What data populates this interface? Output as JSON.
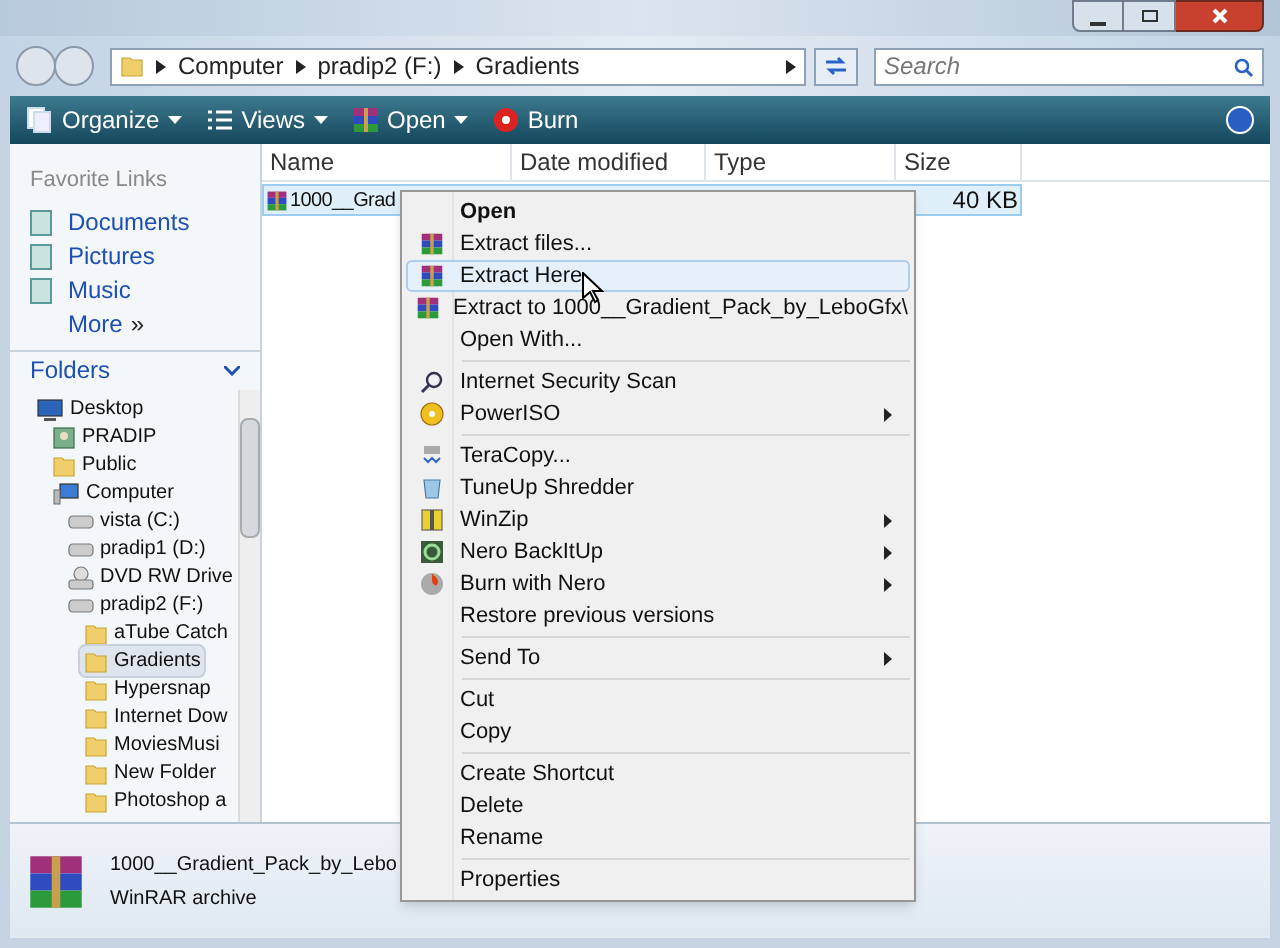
{
  "address": {
    "crumbs": [
      "Computer",
      "pradip2 (F:)",
      "Gradients"
    ]
  },
  "search": {
    "placeholder": "Search"
  },
  "toolbar": [
    "Organize",
    "Views",
    "Open",
    "Burn"
  ],
  "favorites": {
    "title": "Favorite Links",
    "items": [
      "Documents",
      "Pictures",
      "Music"
    ],
    "more": "More",
    "more_glyph": "»"
  },
  "folders": {
    "title": "Folders",
    "tree": [
      {
        "label": "Desktop",
        "kind": "desktop",
        "selected": false,
        "children": [
          {
            "label": "PRADIP",
            "kind": "user",
            "selected": false
          },
          {
            "label": "Public",
            "kind": "folder",
            "selected": false
          },
          {
            "label": "Computer",
            "kind": "computer",
            "selected": false,
            "children": [
              {
                "label": "vista (C:)",
                "kind": "drive",
                "selected": false
              },
              {
                "label": "pradip1 (D:)",
                "kind": "drive",
                "selected": false
              },
              {
                "label": "DVD RW Drive",
                "kind": "dvd",
                "selected": false
              },
              {
                "label": "pradip2 (F:)",
                "kind": "drive",
                "selected": false,
                "children": [
                  {
                    "label": "aTube Catch",
                    "kind": "folder",
                    "selected": false
                  },
                  {
                    "label": "Gradients",
                    "kind": "folder",
                    "selected": true
                  },
                  {
                    "label": "Hypersnap",
                    "kind": "folder",
                    "selected": false
                  },
                  {
                    "label": "Internet Dow",
                    "kind": "folder",
                    "selected": false
                  },
                  {
                    "label": "MoviesMusi",
                    "kind": "folder",
                    "selected": false
                  },
                  {
                    "label": "New Folder",
                    "kind": "folder",
                    "selected": false
                  },
                  {
                    "label": "Photoshop a",
                    "kind": "folder",
                    "selected": false
                  }
                ]
              }
            ]
          }
        ]
      }
    ]
  },
  "columns": [
    "Name",
    "Date modified",
    "Type",
    "Size"
  ],
  "files": [
    {
      "name": "1000__Grad",
      "size": "40 KB",
      "selected": true
    }
  ],
  "menu": [
    {
      "kind": "item",
      "label": "Open",
      "default": true,
      "selected": false,
      "submenu": false
    },
    {
      "kind": "item",
      "label": "Extract files...",
      "selected": false,
      "submenu": false
    },
    {
      "kind": "item",
      "label": "Extract Here",
      "selected": true,
      "submenu": false
    },
    {
      "kind": "item",
      "label": "Extract to 1000__Gradient_Pack_by_LeboGfx\\",
      "selected": false,
      "submenu": false
    },
    {
      "kind": "item",
      "label": "Open With...",
      "selected": false,
      "submenu": false
    },
    {
      "kind": "separator"
    },
    {
      "kind": "item",
      "label": "Internet Security Scan",
      "selected": false,
      "submenu": false
    },
    {
      "kind": "item",
      "label": "PowerISO",
      "selected": false,
      "submenu": true
    },
    {
      "kind": "separator"
    },
    {
      "kind": "item",
      "label": "TeraCopy...",
      "selected": false,
      "submenu": false
    },
    {
      "kind": "item",
      "label": "TuneUp Shredder",
      "selected": false,
      "submenu": false
    },
    {
      "kind": "item",
      "label": "WinZip",
      "selected": false,
      "submenu": true
    },
    {
      "kind": "item",
      "label": "Nero BackItUp",
      "selected": false,
      "submenu": true
    },
    {
      "kind": "item",
      "label": "Burn with Nero",
      "selected": false,
      "submenu": true
    },
    {
      "kind": "item",
      "label": "Restore previous versions",
      "selected": false,
      "submenu": false
    },
    {
      "kind": "separator"
    },
    {
      "kind": "item",
      "label": "Send To",
      "selected": false,
      "submenu": true
    },
    {
      "kind": "separator"
    },
    {
      "kind": "item",
      "label": "Cut",
      "selected": false,
      "submenu": false
    },
    {
      "kind": "item",
      "label": "Copy",
      "selected": false,
      "submenu": false
    },
    {
      "kind": "separator"
    },
    {
      "kind": "item",
      "label": "Create Shortcut",
      "selected": false,
      "submenu": false
    },
    {
      "kind": "item",
      "label": "Delete",
      "selected": false,
      "submenu": false
    },
    {
      "kind": "item",
      "label": "Rename",
      "selected": false,
      "submenu": false
    },
    {
      "kind": "separator"
    },
    {
      "kind": "item",
      "label": "Properties",
      "selected": false,
      "submenu": false
    }
  ],
  "details": {
    "name": "1000__Gradient_Pack_by_Lebo",
    "type": "WinRAR archive"
  }
}
